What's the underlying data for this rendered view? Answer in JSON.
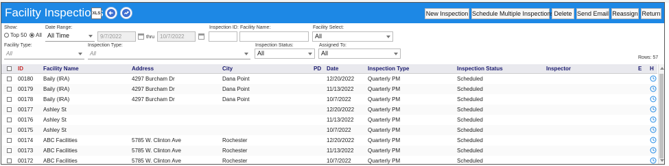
{
  "header": {
    "title": "Facility Inspections",
    "xls_label": "XLS",
    "buttons": {
      "new_inspection": "New Inspection",
      "schedule_multiple": "Schedule Multiple Inspections",
      "delete": "Delete",
      "send_email": "Send Email",
      "reassign": "Reassign",
      "return": "Return"
    },
    "colors": {
      "bar": "#1d88e5",
      "title_text": "#ffffff"
    }
  },
  "filters": {
    "show_label": "Show:",
    "top50_label": "Top 50",
    "all_label": "All",
    "show_selected": "All",
    "date_range_label": "Date Range:",
    "date_range_value": "All Time",
    "date_from": "9/7/2022",
    "thru_label": "thru",
    "date_to": "10/7/2022",
    "inspection_id_label": "Inspection ID:",
    "inspection_id_value": "",
    "facility_name_label": "Facility Name:",
    "facility_name_value": "",
    "facility_select_label": "Facility Select:",
    "facility_select_value": "All",
    "facility_type_label": "Facility Type:",
    "facility_type_value": "All",
    "inspection_type_label": "Inspection Type:",
    "inspection_type_value": "All",
    "inspection_status_label": "Inspection Status:",
    "inspection_status_value": "All",
    "assigned_to_label": "Assigned To:",
    "assigned_to_value": "All",
    "rows_count": "Rows: 57"
  },
  "table": {
    "headers": {
      "id": "ID",
      "facility_name": "Facility Name",
      "address": "Address",
      "city": "City",
      "pd": "PD",
      "date": "Date",
      "inspection_type": "Inspection Type",
      "inspection_status": "Inspection Status",
      "inspector": "Inspector",
      "e": "E",
      "h": "H"
    },
    "rows": [
      {
        "id": "00180",
        "facility_name": "Baily (IRA)",
        "address": "4297 Burcham Dr",
        "city": "Dana Point",
        "date": "12/20/2022",
        "inspection_type": "Quarterly PM",
        "inspection_status": "Scheduled"
      },
      {
        "id": "00179",
        "facility_name": "Baily (IRA)",
        "address": "4297 Burcham Dr",
        "city": "Dana Point",
        "date": "11/13/2022",
        "inspection_type": "Quarterly PM",
        "inspection_status": "Scheduled"
      },
      {
        "id": "00178",
        "facility_name": "Baily (IRA)",
        "address": "4297 Burcham Dr",
        "city": "Dana Point",
        "date": "10/7/2022",
        "inspection_type": "Quarterly PM",
        "inspection_status": "Scheduled"
      },
      {
        "id": "00177",
        "facility_name": "Ashley St",
        "address": "",
        "city": "",
        "date": "12/20/2022",
        "inspection_type": "Quarterly PM",
        "inspection_status": "Scheduled"
      },
      {
        "id": "00176",
        "facility_name": "Ashley St",
        "address": "",
        "city": "",
        "date": "11/13/2022",
        "inspection_type": "Quarterly PM",
        "inspection_status": "Scheduled"
      },
      {
        "id": "00175",
        "facility_name": "Ashley St",
        "address": "",
        "city": "",
        "date": "10/7/2022",
        "inspection_type": "Quarterly PM",
        "inspection_status": "Scheduled"
      },
      {
        "id": "00174",
        "facility_name": "ABC Facilities",
        "address": "5785 W. Clinton Ave",
        "city": "Rochester",
        "date": "12/20/2022",
        "inspection_type": "Quarterly PM",
        "inspection_status": "Scheduled"
      },
      {
        "id": "00173",
        "facility_name": "ABC Facilities",
        "address": "5785 W. Clinton Ave",
        "city": "Rochester",
        "date": "11/13/2022",
        "inspection_type": "Quarterly PM",
        "inspection_status": "Scheduled"
      },
      {
        "id": "00172",
        "facility_name": "ABC Facilities",
        "address": "5785 W. Clinton Ave",
        "city": "Rochester",
        "date": "10/7/2022",
        "inspection_type": "Quarterly PM",
        "inspection_status": "Scheduled"
      }
    ]
  }
}
